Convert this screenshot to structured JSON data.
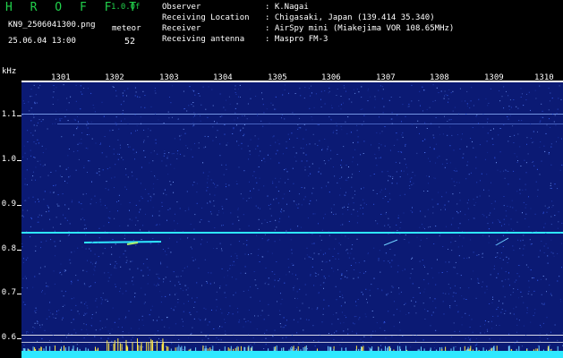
{
  "header": {
    "title": "H R O F F T",
    "version": "1.0.0f",
    "filename": "KN9_2506041300.png",
    "datetime": "25.06.04 13:00",
    "mode_label": "meteor",
    "count": "52"
  },
  "info": [
    {
      "label": "Observer",
      "value": ": K.Nagai"
    },
    {
      "label": "Receiving Location",
      "value": ": Chigasaki, Japan (139.414 35.340)"
    },
    {
      "label": "Receiver",
      "value": ": AirSpy mini (Miakejima VOR 108.65MHz)"
    },
    {
      "label": "Receiving antenna",
      "value": ": Maspro FM-3"
    }
  ],
  "axis": {
    "unit": "kHz",
    "y_ticks": [
      "1.1",
      "1.0",
      "0.9",
      "0.8",
      "0.7",
      "0.6"
    ],
    "x_ticks": [
      "1301",
      "1302",
      "1303",
      "1304",
      "1305",
      "1306",
      "1307",
      "1308",
      "1309",
      "1310"
    ]
  },
  "colors": {
    "background": "#0b1a74",
    "accent_green": "#21d04b",
    "signal_cyan": "#2ee8ff",
    "burst_yellow": "#ffe84a"
  }
}
